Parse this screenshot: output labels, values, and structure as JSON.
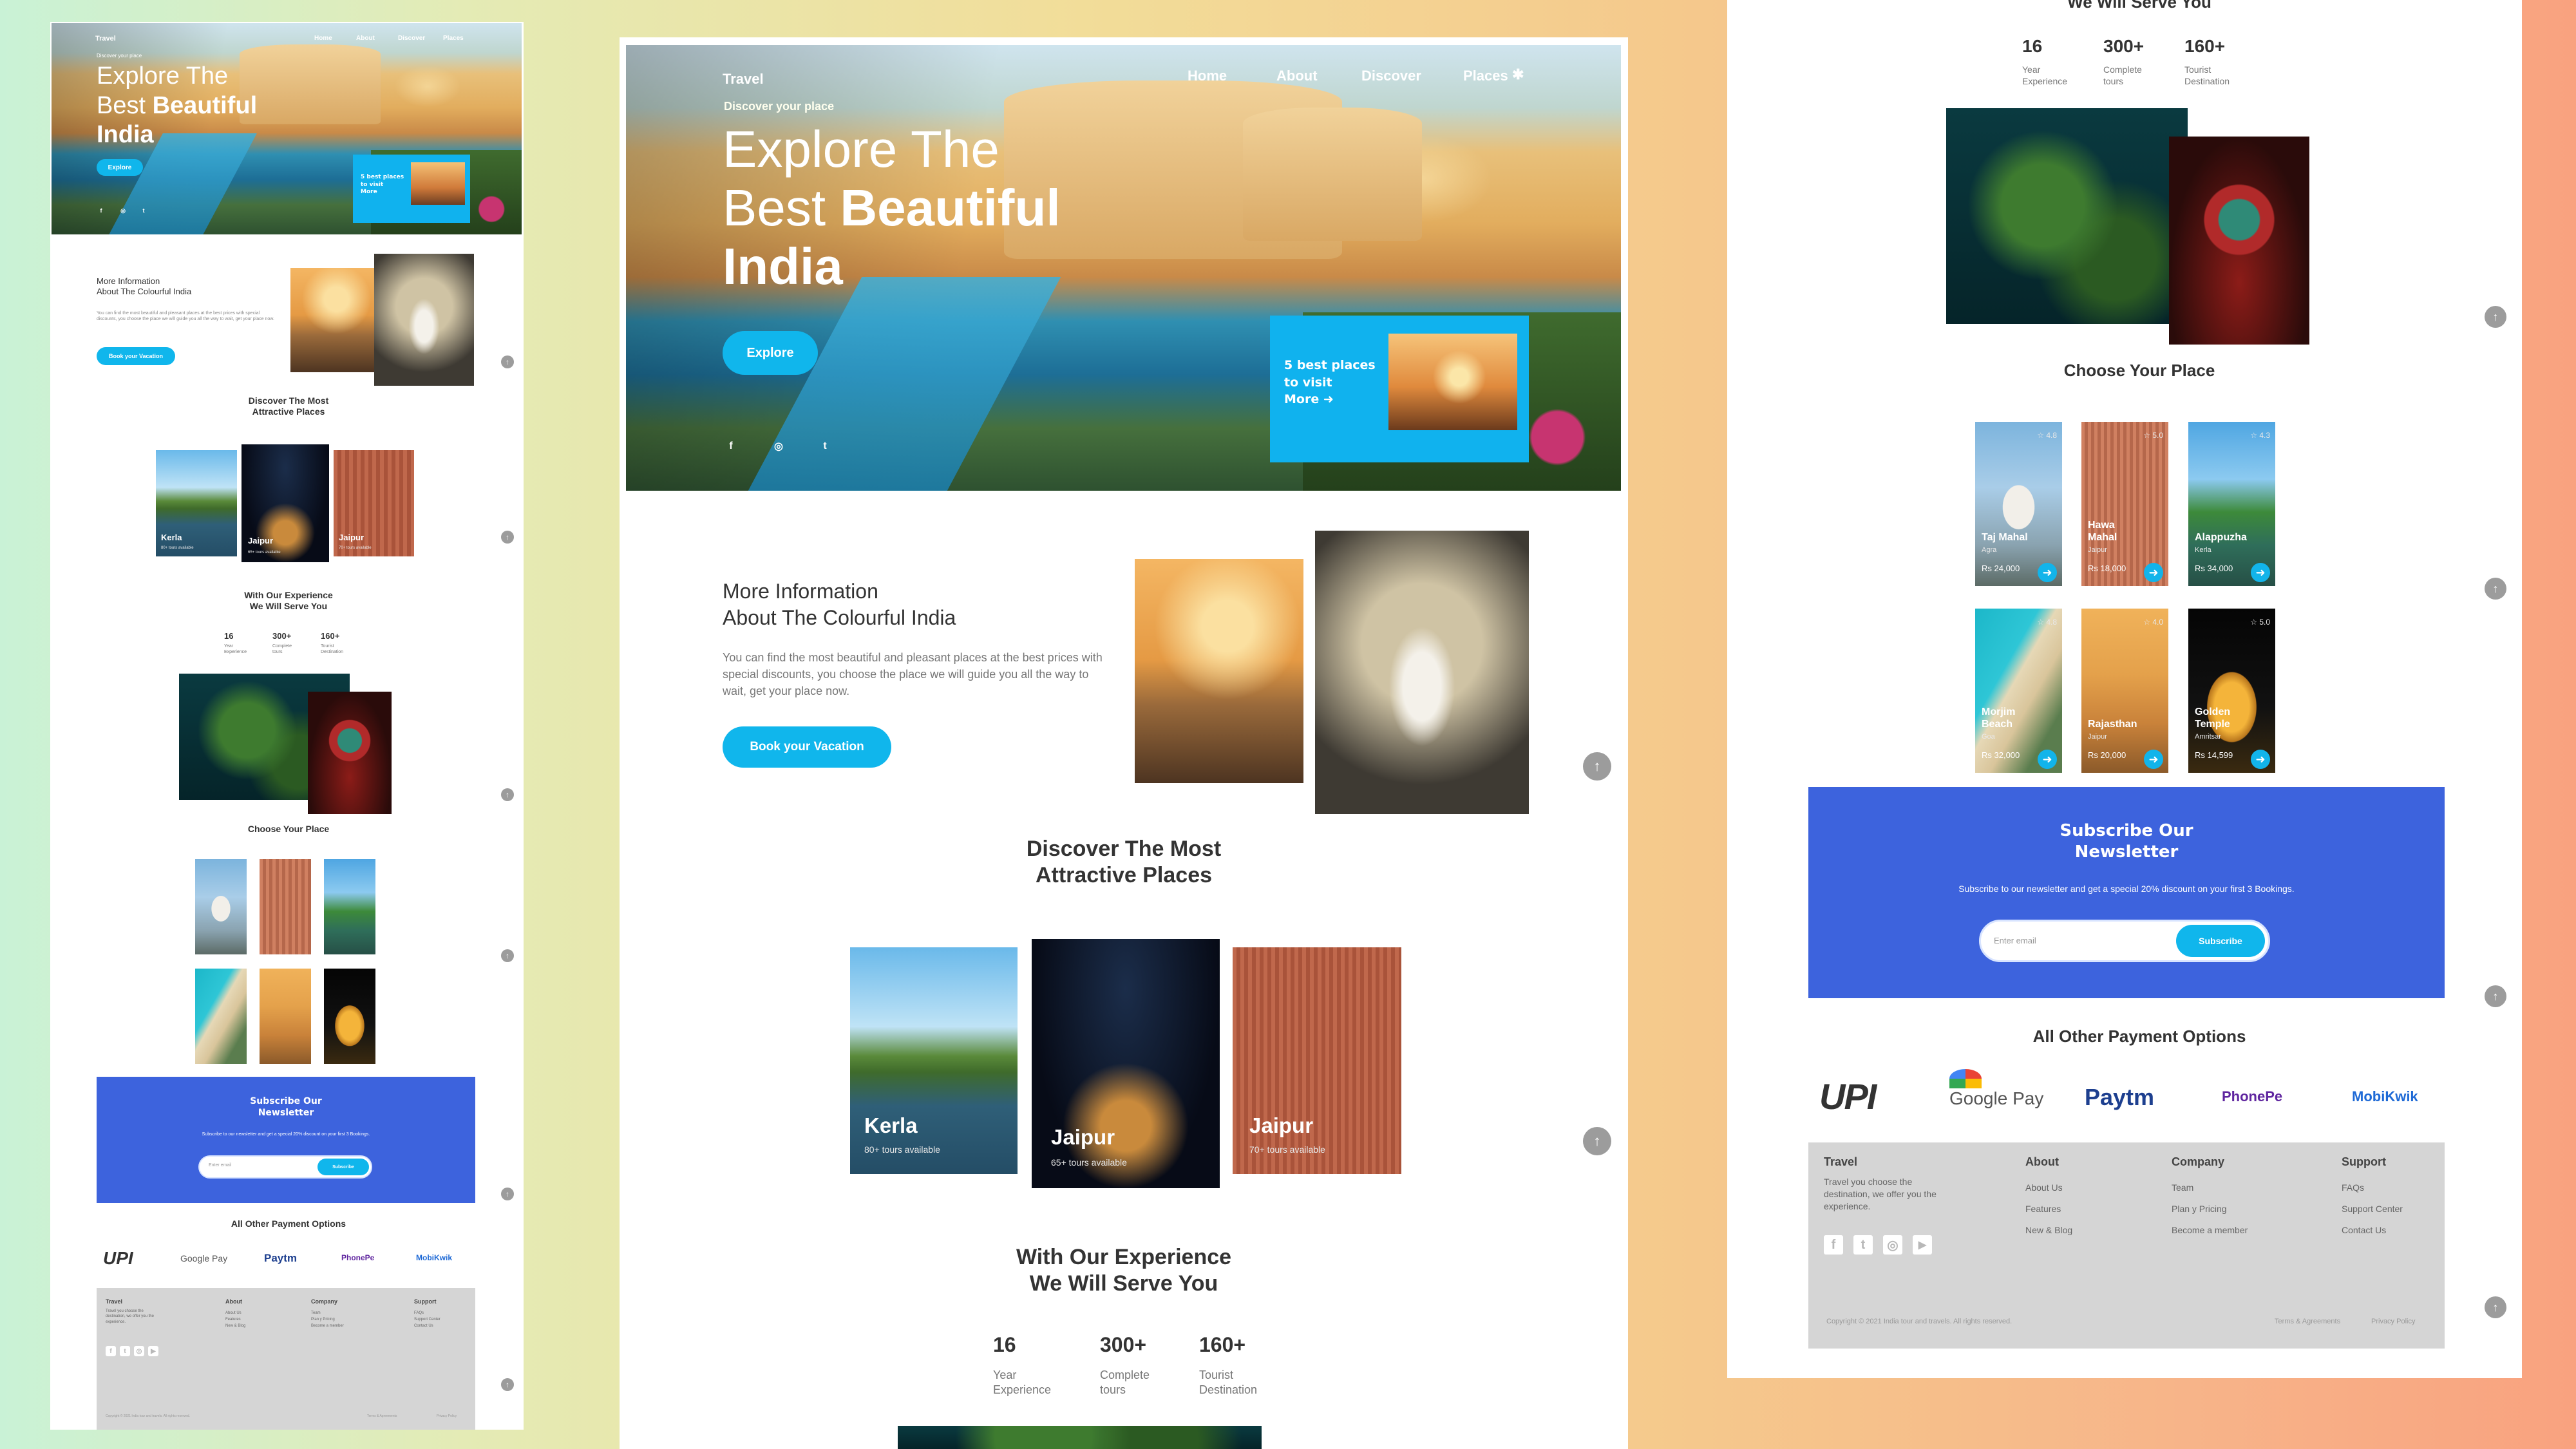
{
  "hero": {
    "brand": "Travel",
    "nav": [
      "Home",
      "About",
      "Discover",
      "Places"
    ],
    "kicker": "Discover your place",
    "title_l1": "Explore The",
    "title_l2a": "Best ",
    "title_l2b": "Beautiful",
    "title_l3": "India",
    "explore_label": "Explore",
    "promo": {
      "line1": "5 best places",
      "line2": "to visit",
      "more": "More"
    }
  },
  "info": {
    "heading_l1": "More Information",
    "heading_l2": "About The Colourful India",
    "body": "You can find the most beautiful and pleasant places at the best prices with special discounts, you choose the place we will guide you all the way to wait, get your place now.",
    "cta": "Book your Vacation"
  },
  "discover": {
    "heading_l1": "Discover The Most",
    "heading_l2": "Attractive Places",
    "cards": [
      {
        "name": "Kerla",
        "sub": "80+ tours available"
      },
      {
        "name": "Jaipur",
        "sub": "65+ tours available"
      },
      {
        "name": "Jaipur",
        "sub": "70+ tours available"
      }
    ]
  },
  "experience": {
    "heading_l1": "With Our Experience",
    "heading_l2": "We Will Serve You",
    "stats": [
      {
        "value": "16",
        "label_l1": "Year",
        "label_l2": "Experience"
      },
      {
        "value": "300+",
        "label_l1": "Complete",
        "label_l2": "tours"
      },
      {
        "value": "160+",
        "label_l1": "Tourist",
        "label_l2": "Destination"
      }
    ]
  },
  "choose": {
    "heading": "Choose Your Place",
    "cards": [
      {
        "name": "Taj Mahal",
        "place": "Agra",
        "price": "Rs 24,000",
        "rating": "4.8"
      },
      {
        "name": "Hawa Mahal",
        "place": "Jaipur",
        "price": "Rs 18,000",
        "rating": "5.0"
      },
      {
        "name": "Alappuzha",
        "place": "Kerla",
        "price": "Rs 34,000",
        "rating": "4.3"
      },
      {
        "name": "Morjim Beach",
        "place": "Goa",
        "price": "Rs 32,000",
        "rating": "4.8"
      },
      {
        "name": "Rajasthan",
        "place": "Jaipur",
        "price": "Rs 20,000",
        "rating": "4.0"
      },
      {
        "name": "Golden Temple",
        "place": "Amritsar",
        "price": "Rs 14,599",
        "rating": "5.0"
      }
    ]
  },
  "newsletter": {
    "heading_l1": "Subscribe Our",
    "heading_l2": "Newsletter",
    "body": "Subscribe to our newsletter and get a special 20% discount on your first 3 Bookings.",
    "placeholder": "Enter email",
    "button": "Subscribe"
  },
  "payments": {
    "heading": "All Other Payment Options",
    "logos": [
      "UPI",
      "Google Pay",
      "Paytm",
      "PhonePe",
      "MobiKwik"
    ]
  },
  "footer": {
    "col1": {
      "title": "Travel",
      "l1": "Travel you choose the",
      "l2": "destination, we offer you the",
      "l3": "experience."
    },
    "col2": {
      "title": "About",
      "items": [
        "About Us",
        "Features",
        "New & Blog"
      ]
    },
    "col3": {
      "title": "Company",
      "items": [
        "Team",
        "Plan y Pricing",
        "Become a member"
      ]
    },
    "col4": {
      "title": "Support",
      "items": [
        "FAQs",
        "Support Center",
        "Contact Us"
      ]
    },
    "copyright": "Copyright © 2021 India tour and travels. All rights reserved.",
    "terms": "Terms & Agreements",
    "privacy": "Privacy Policy"
  },
  "colors": {
    "cyan": "#10b6ec",
    "blue": "#3d63dd",
    "footer": "#d5d5d5"
  }
}
